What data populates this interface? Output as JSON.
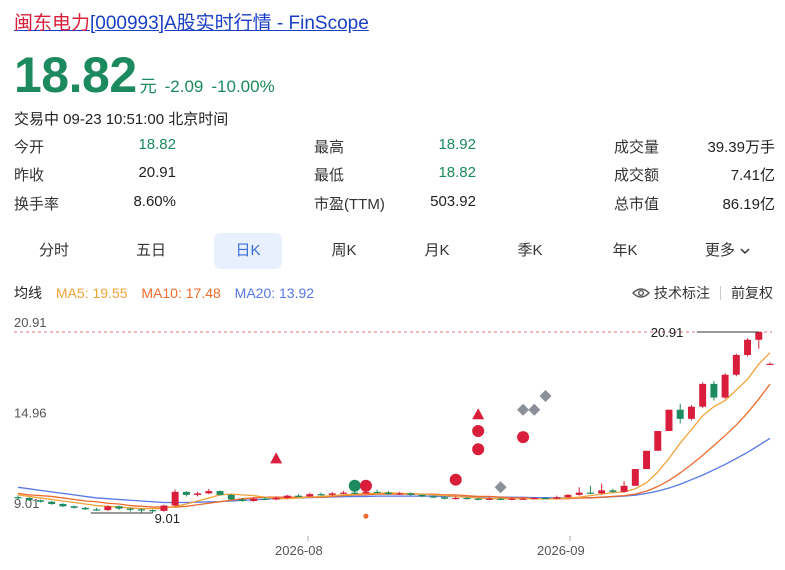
{
  "header": {
    "title_name": "闽东电力",
    "title_rest": "[000993]A股实时行情 - FinScope"
  },
  "quote": {
    "price": "18.82",
    "unit": "元",
    "change": "-2.09",
    "change_pct": "-10.00%",
    "status": "交易中 09-23 10:51:00 北京时间"
  },
  "stats": {
    "open_label": "今开",
    "open_value": "18.82",
    "prev_close_label": "昨收",
    "prev_close_value": "20.91",
    "turnover_label": "换手率",
    "turnover_value": "8.60%",
    "high_label": "最高",
    "high_value": "18.92",
    "low_label": "最低",
    "low_value": "18.82",
    "pe_label": "市盈(TTM)",
    "pe_value": "503.92",
    "volume_label": "成交量",
    "volume_value": "39.39万手",
    "amount_label": "成交额",
    "amount_value": "7.41亿",
    "mktcap_label": "总市值",
    "mktcap_value": "86.19亿"
  },
  "tabs": [
    "分时",
    "五日",
    "日K",
    "周K",
    "月K",
    "季K",
    "年K",
    "更多"
  ],
  "active_tab": "日K",
  "legend": {
    "label": "均线",
    "ma5": "MA5: 19.55",
    "ma10": "MA10: 17.48",
    "ma20": "MA20: 13.92"
  },
  "controls": {
    "indicator": "技术标注",
    "adjust": "前复权"
  },
  "colors": {
    "up": "#d81e3b",
    "down": "#1c8a5e",
    "ma5": "#f0a33a",
    "ma10": "#ee6a2d",
    "ma20": "#5677e6",
    "accent": "#3a6fd8"
  },
  "chart_data": {
    "type": "candlestick",
    "y_ticks": [
      "20.91",
      "14.96",
      "9.01"
    ],
    "x_ticks": [
      "2026-08",
      "2026-09"
    ],
    "ylim": [
      9.01,
      20.91
    ],
    "max_label": "20.91",
    "min_label": "9.01",
    "prev_close_line": 20.91,
    "candles": [
      [
        10.05,
        10.0,
        10.15,
        9.9
      ],
      [
        10.0,
        9.85,
        10.05,
        9.8
      ],
      [
        9.85,
        9.75,
        9.9,
        9.7
      ],
      [
        9.75,
        9.6,
        9.8,
        9.55
      ],
      [
        9.6,
        9.45,
        9.65,
        9.4
      ],
      [
        9.45,
        9.35,
        9.5,
        9.3
      ],
      [
        9.35,
        9.25,
        9.4,
        9.2
      ],
      [
        9.25,
        9.2,
        9.35,
        9.15
      ],
      [
        9.2,
        9.45,
        9.5,
        9.15
      ],
      [
        9.45,
        9.3,
        9.5,
        9.2
      ],
      [
        9.3,
        9.25,
        9.35,
        9.1
      ],
      [
        9.25,
        9.2,
        9.3,
        9.05
      ],
      [
        9.2,
        9.15,
        9.25,
        9.01
      ],
      [
        9.15,
        9.5,
        9.55,
        9.1
      ],
      [
        9.5,
        10.4,
        10.55,
        9.45
      ],
      [
        10.4,
        10.2,
        10.45,
        10.1
      ],
      [
        10.2,
        10.3,
        10.4,
        10.1
      ],
      [
        10.3,
        10.45,
        10.6,
        10.25
      ],
      [
        10.45,
        10.2,
        10.5,
        10.15
      ],
      [
        10.2,
        9.9,
        10.25,
        9.85
      ],
      [
        9.9,
        9.8,
        10.0,
        9.75
      ],
      [
        9.8,
        9.95,
        10.05,
        9.75
      ],
      [
        9.95,
        9.9,
        10.05,
        9.85
      ],
      [
        9.9,
        10.0,
        10.1,
        9.85
      ],
      [
        10.0,
        10.15,
        10.2,
        9.95
      ],
      [
        10.15,
        10.1,
        10.25,
        10.05
      ],
      [
        10.1,
        10.25,
        10.35,
        10.05
      ],
      [
        10.25,
        10.2,
        10.35,
        10.15
      ],
      [
        10.2,
        10.3,
        10.4,
        10.15
      ],
      [
        10.3,
        10.35,
        10.45,
        10.25
      ],
      [
        10.35,
        10.3,
        10.45,
        10.25
      ],
      [
        10.3,
        10.4,
        10.5,
        10.25
      ],
      [
        10.4,
        10.35,
        10.55,
        10.3
      ],
      [
        10.35,
        10.25,
        10.45,
        10.2
      ],
      [
        10.25,
        10.3,
        10.4,
        10.2
      ],
      [
        10.3,
        10.2,
        10.35,
        10.15
      ],
      [
        10.2,
        10.1,
        10.25,
        10.05
      ],
      [
        10.1,
        10.05,
        10.15,
        10.0
      ],
      [
        10.05,
        9.95,
        10.1,
        9.9
      ],
      [
        9.95,
        10.0,
        10.1,
        9.9
      ],
      [
        10.0,
        9.95,
        10.05,
        9.9
      ],
      [
        9.95,
        9.9,
        10.0,
        9.85
      ],
      [
        9.9,
        9.95,
        10.05,
        9.85
      ],
      [
        9.95,
        9.9,
        10.0,
        9.85
      ],
      [
        9.9,
        9.95,
        10.05,
        9.85
      ],
      [
        9.95,
        9.95,
        10.05,
        9.9
      ],
      [
        9.95,
        10.0,
        10.05,
        9.9
      ],
      [
        10.0,
        9.95,
        10.05,
        9.9
      ],
      [
        9.95,
        10.05,
        10.15,
        9.9
      ],
      [
        10.05,
        10.2,
        10.25,
        10.0
      ],
      [
        10.2,
        10.35,
        10.7,
        10.15
      ],
      [
        10.35,
        10.3,
        10.8,
        10.25
      ],
      [
        10.3,
        10.5,
        10.95,
        10.25
      ],
      [
        10.5,
        10.4,
        10.6,
        10.35
      ],
      [
        10.4,
        10.8,
        11.1,
        10.35
      ],
      [
        10.8,
        11.9,
        11.9,
        10.8
      ],
      [
        11.9,
        13.1,
        13.1,
        11.9
      ],
      [
        13.1,
        14.4,
        14.4,
        13.1
      ],
      [
        14.4,
        15.8,
        15.8,
        14.4
      ],
      [
        15.8,
        15.2,
        16.2,
        14.9
      ],
      [
        15.2,
        16.0,
        16.1,
        15.1
      ],
      [
        16.0,
        17.5,
        17.6,
        15.9
      ],
      [
        17.5,
        16.6,
        17.7,
        16.4
      ],
      [
        16.6,
        18.1,
        18.2,
        16.5
      ],
      [
        18.1,
        19.4,
        19.5,
        18.0
      ],
      [
        19.4,
        20.4,
        20.5,
        19.3
      ],
      [
        20.4,
        20.91,
        20.91,
        19.8
      ],
      [
        18.82,
        18.82,
        18.92,
        18.82
      ]
    ],
    "ma5": [
      10.2,
      10.1,
      10.0,
      9.9,
      9.8,
      9.7,
      9.6,
      9.5,
      9.45,
      9.4,
      9.35,
      9.3,
      9.3,
      9.3,
      9.45,
      9.6,
      9.8,
      10.0,
      10.2,
      10.25,
      10.2,
      10.15,
      10.05,
      9.95,
      9.95,
      10.0,
      10.05,
      10.1,
      10.15,
      10.2,
      10.25,
      10.3,
      10.3,
      10.35,
      10.3,
      10.3,
      10.25,
      10.2,
      10.15,
      10.1,
      10.05,
      10.0,
      9.95,
      9.95,
      9.95,
      9.95,
      9.95,
      9.95,
      9.95,
      10.0,
      10.05,
      10.15,
      10.25,
      10.35,
      10.4,
      10.6,
      11.0,
      11.7,
      12.6,
      13.6,
      14.5,
      15.4,
      16.0,
      16.4,
      17.1,
      17.8,
      18.8,
      19.55
    ],
    "ma10": [
      10.3,
      10.2,
      10.15,
      10.1,
      10.0,
      9.9,
      9.8,
      9.75,
      9.65,
      9.6,
      9.5,
      9.45,
      9.4,
      9.4,
      9.4,
      9.45,
      9.55,
      9.65,
      9.75,
      9.85,
      9.95,
      10.0,
      10.05,
      10.05,
      10.05,
      10.05,
      10.05,
      10.05,
      10.1,
      10.15,
      10.2,
      10.2,
      10.25,
      10.25,
      10.25,
      10.25,
      10.25,
      10.25,
      10.2,
      10.2,
      10.15,
      10.1,
      10.1,
      10.05,
      10.0,
      10.0,
      9.95,
      9.95,
      9.95,
      9.95,
      10.0,
      10.0,
      10.05,
      10.1,
      10.15,
      10.25,
      10.45,
      10.75,
      11.15,
      11.65,
      12.2,
      12.8,
      13.45,
      14.1,
      14.8,
      15.6,
      16.5,
      17.48
    ],
    "ma20": [
      10.7,
      10.6,
      10.5,
      10.4,
      10.3,
      10.2,
      10.1,
      10.0,
      9.95,
      9.9,
      9.85,
      9.8,
      9.75,
      9.7,
      9.7,
      9.7,
      9.72,
      9.74,
      9.76,
      9.8,
      9.84,
      9.88,
      9.92,
      9.96,
      10.0,
      10.0,
      10.02,
      10.04,
      10.06,
      10.08,
      10.1,
      10.1,
      10.12,
      10.12,
      10.12,
      10.12,
      10.12,
      10.12,
      10.1,
      10.1,
      10.08,
      10.08,
      10.06,
      10.06,
      10.04,
      10.04,
      10.02,
      10.02,
      10.0,
      10.0,
      10.0,
      10.02,
      10.04,
      10.08,
      10.12,
      10.18,
      10.3,
      10.45,
      10.65,
      10.9,
      11.2,
      11.5,
      11.85,
      12.2,
      12.6,
      13.0,
      13.45,
      13.92
    ],
    "markers": [
      {
        "kind": "triangle",
        "index": 23,
        "price": 12.6,
        "color": "#d81e3b"
      },
      {
        "kind": "dot",
        "index": 30,
        "price": 10.8,
        "color": "#1c8a5e"
      },
      {
        "kind": "dot",
        "index": 31,
        "price": 10.8,
        "color": "#d81e3b"
      },
      {
        "kind": "small-dot",
        "index": 31,
        "price": 8.8,
        "color": "#ee6a2d"
      },
      {
        "kind": "dot",
        "index": 39,
        "price": 11.2,
        "color": "#d81e3b"
      },
      {
        "kind": "triangle",
        "index": 41,
        "price": 15.5,
        "color": "#d81e3b"
      },
      {
        "kind": "dot",
        "index": 41,
        "price": 14.4,
        "color": "#d81e3b"
      },
      {
        "kind": "dot",
        "index": 41,
        "price": 13.2,
        "color": "#d81e3b"
      },
      {
        "kind": "diamond",
        "index": 43,
        "price": 10.7,
        "color": "#8a8f98"
      },
      {
        "kind": "dot",
        "index": 45,
        "price": 14.0,
        "color": "#d81e3b"
      },
      {
        "kind": "diamond",
        "index": 45,
        "price": 15.8,
        "color": "#8a8f98"
      },
      {
        "kind": "diamond",
        "index": 46,
        "price": 15.8,
        "color": "#8a8f98"
      },
      {
        "kind": "diamond",
        "index": 47,
        "price": 16.7,
        "color": "#8a8f98"
      }
    ]
  }
}
